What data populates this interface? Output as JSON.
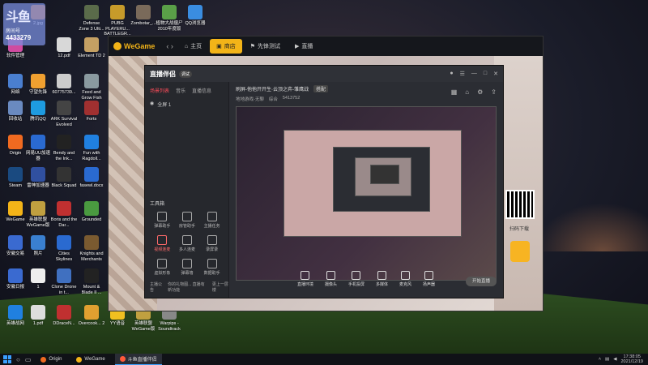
{
  "stream_overlay": {
    "logo": "斗鱼",
    "room_label": "房间号",
    "room_number": "4433279"
  },
  "desktop_icons": [
    {
      "label": "",
      "color": "#3a7fd8"
    },
    {
      "label": "2.jpg",
      "color": "#e27b2c"
    },
    {
      "label": "Defense Zone 3 Ulti...",
      "color": "#5a6b4a"
    },
    {
      "label": "PUBG PLAYERU... BATTLEGR...",
      "color": "#c79b2a"
    },
    {
      "label": "Zombotar_...",
      "color": "#7a6a5a"
    },
    {
      "label": "植物大战僵尸2010年度版",
      "color": "#5aa048"
    },
    {
      "label": "QQ浏览器",
      "color": "#3a8de0"
    },
    {
      "label": "软件管理",
      "color": "#d04ba0"
    },
    {
      "label": "12.pdf",
      "color": "#d8d8d8"
    },
    {
      "label": "Element TD 2",
      "color": "#c4a063"
    },
    {
      "label": "网络",
      "color": "#4a7fd0"
    },
    {
      "label": "守望先锋",
      "color": "#f0a030"
    },
    {
      "label": "60775739...",
      "color": "#ccc"
    },
    {
      "label": "Feed and Grow Fish",
      "color": "#8a9aa0"
    },
    {
      "label": "回收站",
      "color": "#6a8ac0"
    },
    {
      "label": "腾讯QQ",
      "color": "#1e9be0"
    },
    {
      "label": "ARK Survival Evolved",
      "color": "#444"
    },
    {
      "label": "Forts",
      "color": "#a03030"
    },
    {
      "label": "Origin",
      "color": "#f06a20"
    },
    {
      "label": "网易UU加速器",
      "color": "#2a6ad0"
    },
    {
      "label": "Bendy and the Ink...",
      "color": "#222"
    },
    {
      "label": "Fun with Ragdoll...",
      "color": "#2080e0"
    },
    {
      "label": "Steam",
      "color": "#1a4a80"
    },
    {
      "label": "雷神加速器",
      "color": "#3050a0"
    },
    {
      "label": "Black Squad",
      "color": "#333"
    },
    {
      "label": "fasewl.docx",
      "color": "#2a6ad0"
    },
    {
      "label": "WeGame",
      "color": "#f3b418"
    },
    {
      "label": "英雄联盟WeGame版",
      "color": "#c0a040"
    },
    {
      "label": "Boris and the Dar...",
      "color": "#c03030"
    },
    {
      "label": "Grounded",
      "color": "#4a9a40"
    },
    {
      "label": "安徽交易",
      "color": "#3a6ad0"
    },
    {
      "label": "照片",
      "color": "#3a80d0"
    },
    {
      "label": "Cities Skylines",
      "color": "#2a6ad0"
    },
    {
      "label": "Knights and Merchants",
      "color": "#7a5a30"
    },
    {
      "label": "安徽日报",
      "color": "#3a6ad0"
    },
    {
      "label": "1",
      "color": "#eee"
    },
    {
      "label": "Clone Drone in t...",
      "color": "#4070c0"
    },
    {
      "label": "Mount & Blade II ...",
      "color": "#222"
    },
    {
      "label": "英雄战网",
      "color": "#2080e0"
    },
    {
      "label": "1.pdf",
      "color": "#ddd"
    },
    {
      "label": "DDraceN...",
      "color": "#c03030"
    },
    {
      "label": "Overcook... 2",
      "color": "#e0a030"
    },
    {
      "label": "YY语音",
      "color": "#f0c020"
    },
    {
      "label": "英雄联盟WeGame版",
      "color": "#c0a040"
    },
    {
      "label": "Warpips - Soundtrack",
      "color": "#888"
    }
  ],
  "wegame": {
    "logo": "WeGame",
    "tabs": [
      {
        "label": "主页",
        "icon": "home-icon"
      },
      {
        "label": "商店",
        "icon": "shop-icon",
        "active": true
      },
      {
        "label": "先锋测试",
        "icon": "flag-icon"
      },
      {
        "label": "直播",
        "icon": "live-icon"
      }
    ],
    "qr_label": "扫码下载"
  },
  "zbbl": {
    "logo": "直播伴侣",
    "tag": "调试",
    "left_tabs": [
      "场景列表",
      "音乐",
      "直播信息"
    ],
    "scene": "全屏 1",
    "tools_title": "工具箱",
    "tools": [
      {
        "label": "弹幕助手"
      },
      {
        "label": "房管助手"
      },
      {
        "label": "主播任务"
      },
      {
        "label": "视频连麦",
        "red": true
      },
      {
        "label": "多人连麦"
      },
      {
        "label": "录屏录"
      },
      {
        "label": "虚拟形象"
      },
      {
        "label": "弹幕墙"
      },
      {
        "label": "数据助手"
      }
    ],
    "bottom_left": [
      "主播公告",
      "你的礼物图... 直播有新功能",
      "更上一层楼"
    ],
    "title_text": "刷屏-他他开开生·云顶之弈-雏鹰战",
    "title_tag": "搭配",
    "sub_items": [
      "地地游戏-无聊",
      "综合",
      "5413752"
    ],
    "controls": [
      "直播环境",
      "摄像头",
      "手机投屏",
      "多媒体",
      "麦克风",
      "扬声器"
    ],
    "start_label": "开始直播"
  },
  "taskbar": {
    "items": [
      {
        "label": "Origin",
        "color": "#f06a20"
      },
      {
        "label": "WeGame",
        "color": "#f3b418"
      },
      {
        "label": "斗鱼直播伴侣",
        "color": "#ff5a3a",
        "active": true
      }
    ],
    "time": "17:38:05",
    "date": "2021/12/19"
  }
}
